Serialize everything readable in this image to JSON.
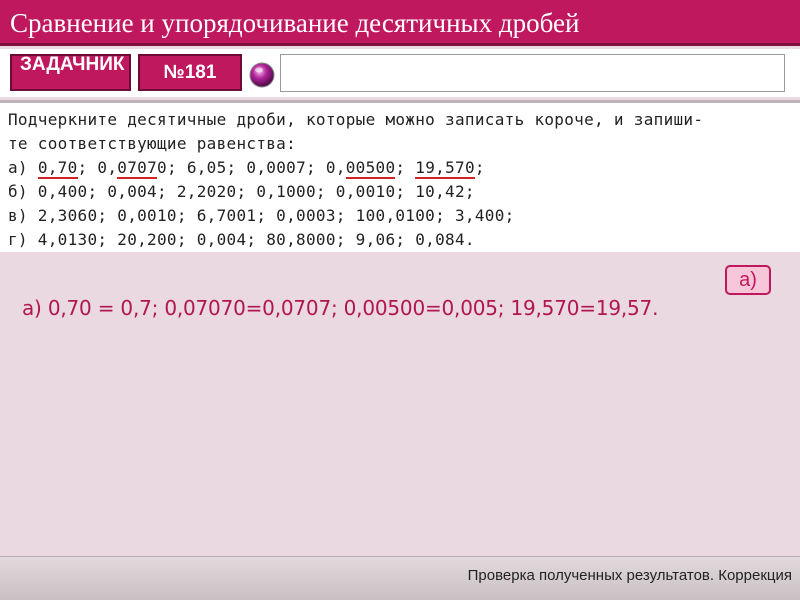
{
  "header": {
    "title": "Сравнение и упорядочивание десятичных дробей"
  },
  "toolbar": {
    "zadachnik_label": "ЗАДАЧНИК",
    "task_number_label": "№181",
    "answer_input_value": ""
  },
  "task": {
    "intro_line1": "Подчеркните десятичные дроби, которые можно записать короче, и запиши-",
    "intro_line2": "те соответствующие равенства:",
    "rows": [
      {
        "parts": [
          {
            "t": "а) "
          },
          {
            "t": "0,70",
            "u": true
          },
          {
            "t": "; 0,"
          },
          {
            "t": "0707",
            "u": true
          },
          {
            "t": "0; 6,05; 0,0007; 0,"
          },
          {
            "t": "00500",
            "u": true
          },
          {
            "t": "; "
          },
          {
            "t": "19,570",
            "u": true
          },
          {
            "t": ";"
          }
        ]
      },
      {
        "parts": [
          {
            "t": "б) 0,400; 0,004; 2,2020; 0,1000; 0,0010; 10,42;"
          }
        ]
      },
      {
        "parts": [
          {
            "t": "в) 2,3060; 0,0010; 6,7001; 0,0003; 100,0100; 3,400;"
          }
        ]
      },
      {
        "parts": [
          {
            "t": "г) 4,0130; 20,200; 0,004; 80,8000; 9,06; 0,084."
          }
        ]
      }
    ]
  },
  "answer": {
    "tag": "а)",
    "text": "а) 0,70 = 0,7; 0,07070=0,0707; 0,00500=0,005; 19,570=19,57."
  },
  "footer": {
    "text": "Проверка полученных результатов. Коррекция"
  },
  "colors": {
    "accent": "#c0185e",
    "underline": "#d52222",
    "answer_text": "#b0164f",
    "background": "#ead9e1"
  },
  "icons": {
    "orb": "purple-orb-icon"
  }
}
